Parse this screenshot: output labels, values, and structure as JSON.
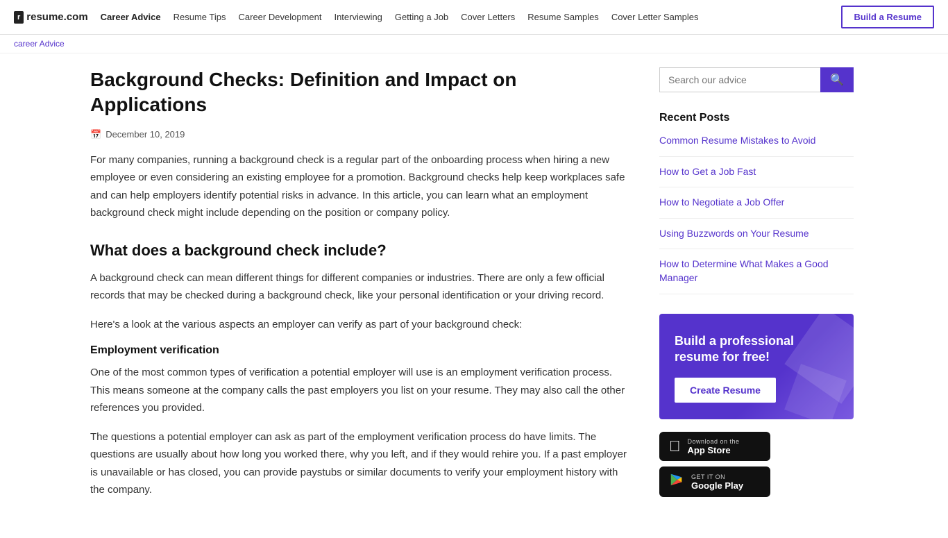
{
  "header": {
    "logo_icon": "r",
    "logo_text": "resume.com",
    "nav": [
      {
        "label": "Career Advice",
        "active": true
      },
      {
        "label": "Resume Tips",
        "active": false
      },
      {
        "label": "Career Development",
        "active": false
      },
      {
        "label": "Interviewing",
        "active": false
      },
      {
        "label": "Getting a Job",
        "active": false
      },
      {
        "label": "Cover Letters",
        "active": false
      },
      {
        "label": "Resume Samples",
        "active": false
      },
      {
        "label": "Cover Letter Samples",
        "active": false
      }
    ],
    "build_resume_label": "Build a Resume"
  },
  "breadcrumb": {
    "career_advice_label": "career Advice"
  },
  "article": {
    "title": "Background Checks: Definition and Impact on Applications",
    "date": "December 10, 2019",
    "intro": "For many companies, running a background check is a regular part of the onboarding process when hiring a new employee or even considering an existing employee for a promotion. Background checks help keep workplaces safe and can help employers identify potential risks in advance. In this article, you can learn what an employment background check might include depending on the position or company policy.",
    "section1_title": "What does a background check include?",
    "section1_para1": "A background check can mean different things for different companies or industries. There are only a few official records that may be checked during a background check, like your personal identification or your driving record.",
    "section1_para2": "Here's a look at the various aspects an employer can verify as part of your background check:",
    "sub1_title": "Employment verification",
    "sub1_para1": "One of the most common types of verification a potential employer will use is an employment verification process. This means someone at the company calls the past employers you list on your resume. They may also call the other references you provided.",
    "sub1_para2": "The questions a potential employer can ask as part of the employment verification process do have limits. The questions are usually about how long you worked there, why you left, and if they would rehire you. If a past employer is unavailable or has closed, you can provide paystubs or similar documents to verify your employment history with the company."
  },
  "sidebar": {
    "search_placeholder": "Search our advice",
    "search_btn_label": "🔍",
    "recent_posts_title": "Recent Posts",
    "recent_posts": [
      {
        "label": "Common Resume Mistakes to Avoid"
      },
      {
        "label": "How to Get a Job Fast"
      },
      {
        "label": "How to Negotiate a Job Offer"
      },
      {
        "label": "Using Buzzwords on Your Resume"
      },
      {
        "label": "How to Determine What Makes a Good Manager"
      }
    ],
    "cta_title": "Build a professional resume for free!",
    "cta_btn_label": "Create Resume",
    "app_store_sub": "Download on the",
    "app_store_name": "App Store",
    "google_play_sub": "GET IT ON",
    "google_play_name": "Google Play"
  }
}
